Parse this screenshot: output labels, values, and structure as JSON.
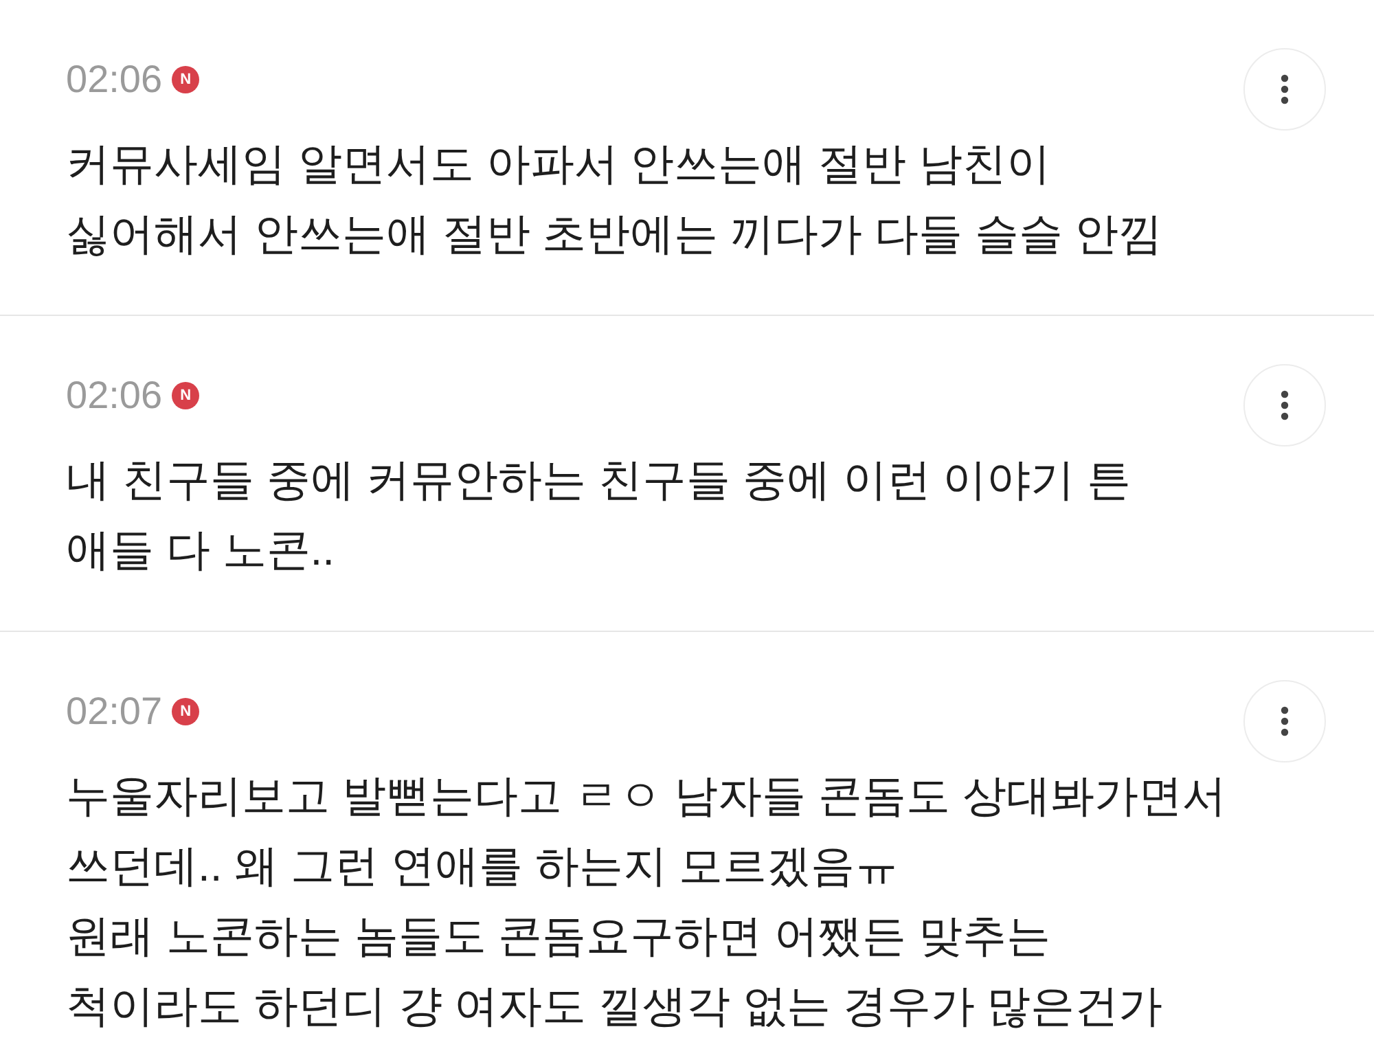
{
  "comments": [
    {
      "time": "02:06",
      "badge": "N",
      "lines": [
        "커뮤사세임 알면서도 아파서 안쓰는애 절반 남친이",
        "싫어해서 안쓰는애 절반 초반에는 끼다가 다들 슬슬 안낌"
      ]
    },
    {
      "time": "02:06",
      "badge": "N",
      "lines": [
        "내 친구들 중에 커뮤안하는 친구들 중에 이런 이야기 튼",
        "애들 다 노콘.."
      ]
    },
    {
      "time": "02:07",
      "badge": "N",
      "lines": [
        "누울자리보고 발뻗는다고 ㄹㅇ 남자들 콘돔도 상대봐가면서",
        "쓰던데.. 왜 그런 연애를 하는지 모르겠음ㅠ",
        "원래 노콘하는 놈들도 콘돔요구하면 어쨌든 맞추는",
        "척이라도 하던디 걍 여자도 낄생각 없는 경우가 많은건가"
      ]
    }
  ]
}
